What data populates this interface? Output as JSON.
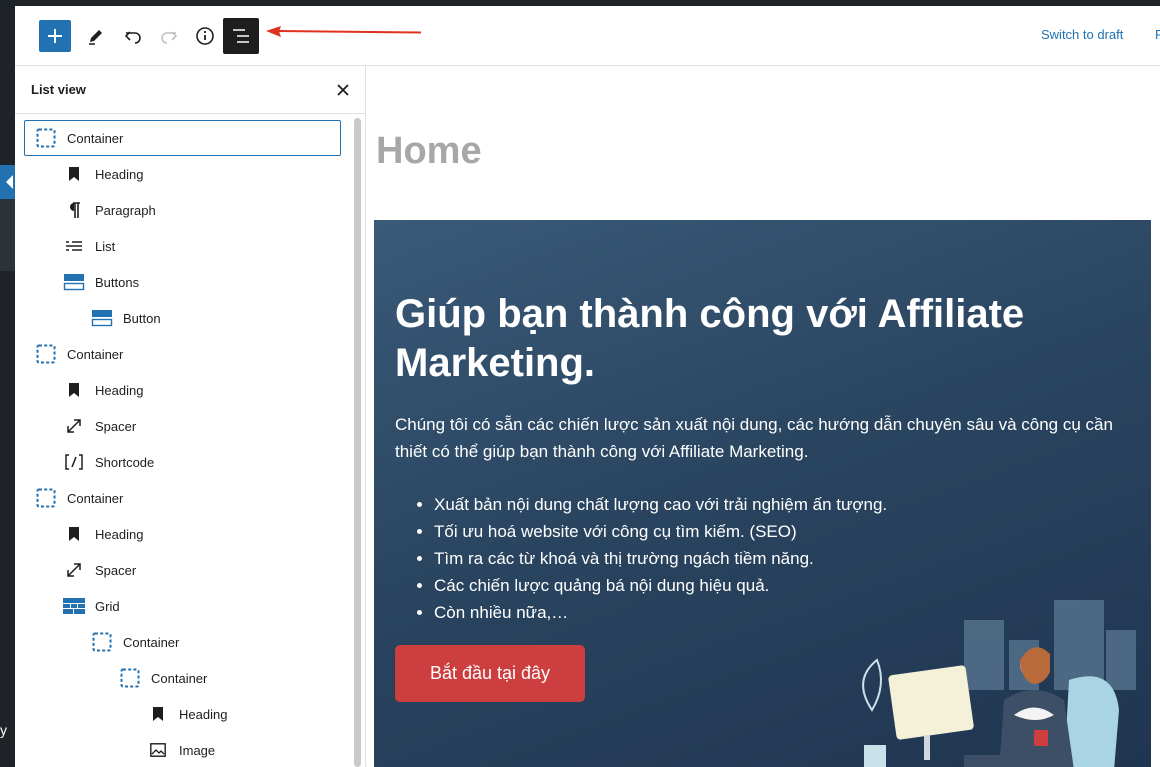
{
  "toolbar": {
    "add_label": "Add block",
    "switch_draft": "Switch to draft",
    "publish_cut": "P"
  },
  "listview": {
    "title": "List view",
    "items": [
      {
        "label": "Container",
        "icon": "container-icon",
        "level": 0,
        "selected": true
      },
      {
        "label": "Heading",
        "icon": "bookmark-icon",
        "level": 1
      },
      {
        "label": "Paragraph",
        "icon": "pilcrow-icon",
        "level": 1
      },
      {
        "label": "List",
        "icon": "list-icon",
        "level": 1
      },
      {
        "label": "Buttons",
        "icon": "buttons-icon",
        "level": 1
      },
      {
        "label": "Button",
        "icon": "buttons-icon",
        "level": 2
      },
      {
        "label": "Container",
        "icon": "container-icon",
        "level": 0
      },
      {
        "label": "Heading",
        "icon": "bookmark-icon",
        "level": 1
      },
      {
        "label": "Spacer",
        "icon": "resize-icon",
        "level": 1
      },
      {
        "label": "Shortcode",
        "icon": "shortcode-icon",
        "level": 1
      },
      {
        "label": "Container",
        "icon": "container-icon",
        "level": 0
      },
      {
        "label": "Heading",
        "icon": "bookmark-icon",
        "level": 1
      },
      {
        "label": "Spacer",
        "icon": "resize-icon",
        "level": 1
      },
      {
        "label": "Grid",
        "icon": "grid-icon",
        "level": 1
      },
      {
        "label": "Container",
        "icon": "container-icon",
        "level": 2
      },
      {
        "label": "Container",
        "icon": "container-icon",
        "level": 3
      },
      {
        "label": "Heading",
        "icon": "bookmark-icon",
        "level": 4
      },
      {
        "label": "Image",
        "icon": "image-icon",
        "level": 4
      }
    ]
  },
  "canvas": {
    "page_title": "Home",
    "hero": {
      "heading": "Giúp bạn thành công với Affiliate Marketing.",
      "paragraph": "Chúng tôi có sẵn các chiến lược sản xuất nội dung, các hướng dẫn chuyên sâu và công cụ cần thiết có thể giúp bạn thành công với Affiliate Marketing.",
      "bullets": [
        "Xuất bản nội dung chất lượng cao với trải nghiệm ấn tượng.",
        "Tối ưu hoá website với công cụ tìm kiếm. (SEO)",
        "Tìm ra các từ khoá và thị trường ngách tiềm năng.",
        "Các chiến lược quảng bá nội dung hiệu quả.",
        "Còn nhiều nữa,…"
      ],
      "button": "Bắt đầu tại đây"
    }
  },
  "colors": {
    "wp_blue": "#2271b1",
    "hero_bg": "#2a4560",
    "cta_red": "#cd3e3e",
    "annotation_red": "#e0301e"
  }
}
